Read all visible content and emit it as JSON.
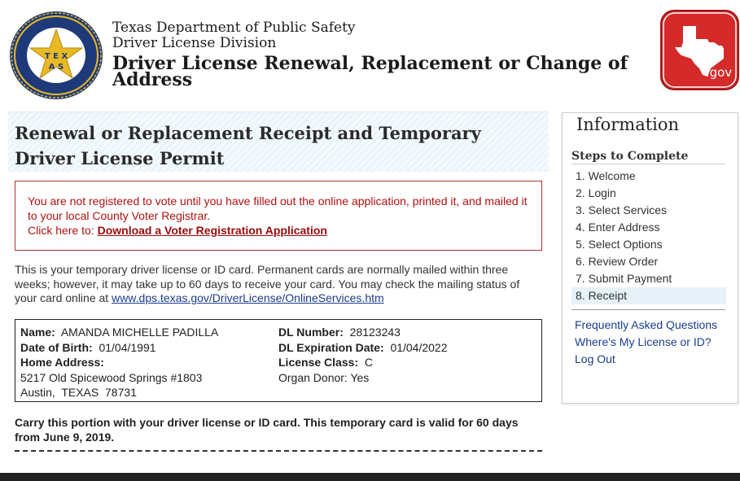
{
  "header": {
    "agency_line1": "Texas Department of Public Safety",
    "agency_line2": "Driver License Division",
    "page_title": "Driver License Renewal, Replacement or Change of Address",
    "seal_text": "DEPARTMENT OF PUBLIC SAFETY · TEXAS · COURTESY · SERVICE · PROTECTION",
    "gov_logo_text": ".gov"
  },
  "main": {
    "heading": "Renewal or Replacement Receipt and Temporary Driver License Permit",
    "alert": {
      "text": "You are not registered to vote until you have filled out the online application, printed it, and mailed it to your local County Voter Registrar.",
      "click_prefix": "Click here to: ",
      "link_label": "Download a Voter Registration Application"
    },
    "info_text": "This is your temporary driver license or ID card. Permanent cards are normally mailed within three weeks; however, it may take up to 60 days to receive your card. You may check the mailing status of your card online at ",
    "info_link": "www.dps.texas.gov/DriverLicense/OnlineServices.htm",
    "card": {
      "name_label": "Name:",
      "name_value": "AMANDA MICHELLE PADILLA",
      "dob_label": "Date of Birth:",
      "dob_value": "01/04/1991",
      "address_label": "Home Address:",
      "address_line1": "5217 Old Spicewood Springs #1803",
      "address_line2": "Austin,  TEXAS  78731",
      "dl_number_label": "DL Number:",
      "dl_number_value": "28123243",
      "dl_exp_label": "DL Expiration Date:",
      "dl_exp_value": "01/04/2022",
      "class_label": "License Class:",
      "class_value": "C",
      "organ_donor": "Organ Donor: Yes"
    },
    "carry_text": "Carry this portion with your driver license or ID card. This temporary card is valid for 60 days from June 9, 2019."
  },
  "sidebar": {
    "title": "Information",
    "steps_heading": "Steps to Complete",
    "steps": [
      "1. Welcome",
      "2. Login",
      "3. Select Services",
      "4. Enter Address",
      "5. Select Options",
      "6. Review Order",
      "7. Submit Payment",
      "8. Receipt"
    ],
    "active_step": 7,
    "links": [
      "Frequently Asked Questions",
      "Where's My License or ID?",
      "Log Out"
    ]
  },
  "colors": {
    "alert_red": "#b01010",
    "link_blue": "#1a3c8c",
    "seal_navy": "#1e3a7a",
    "seal_gold": "#e8b923",
    "gov_red": "#d42a2a"
  },
  "icons": [
    "texas-dps-seal-icon",
    "texas-gov-logo-icon"
  ]
}
